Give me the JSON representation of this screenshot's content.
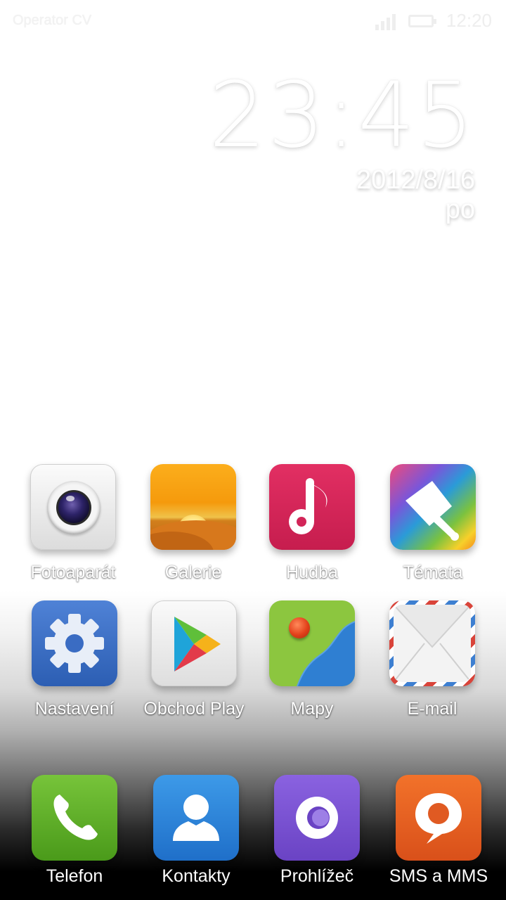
{
  "status_bar": {
    "operator": "Operator CV",
    "time": "12:20"
  },
  "clock_widget": {
    "time": "23:45",
    "date": "2012/8/16",
    "day": "po"
  },
  "home_apps": [
    {
      "label": "Fotoaparát",
      "icon": "camera-icon"
    },
    {
      "label": "Galerie",
      "icon": "gallery-icon"
    },
    {
      "label": "Hudba",
      "icon": "music-icon"
    },
    {
      "label": "Témata",
      "icon": "themes-brush-icon"
    },
    {
      "label": "Nastavení",
      "icon": "settings-gear-icon"
    },
    {
      "label": "Obchod Play",
      "icon": "play-store-icon"
    },
    {
      "label": "Mapy",
      "icon": "maps-icon"
    },
    {
      "label": "E-mail",
      "icon": "email-envelope-icon"
    }
  ],
  "dock_apps": [
    {
      "label": "Telefon",
      "icon": "phone-icon"
    },
    {
      "label": "Kontakty",
      "icon": "contacts-icon"
    },
    {
      "label": "Prohlížeč",
      "icon": "browser-icon"
    },
    {
      "label": "SMS a MMS",
      "icon": "messaging-icon"
    }
  ]
}
